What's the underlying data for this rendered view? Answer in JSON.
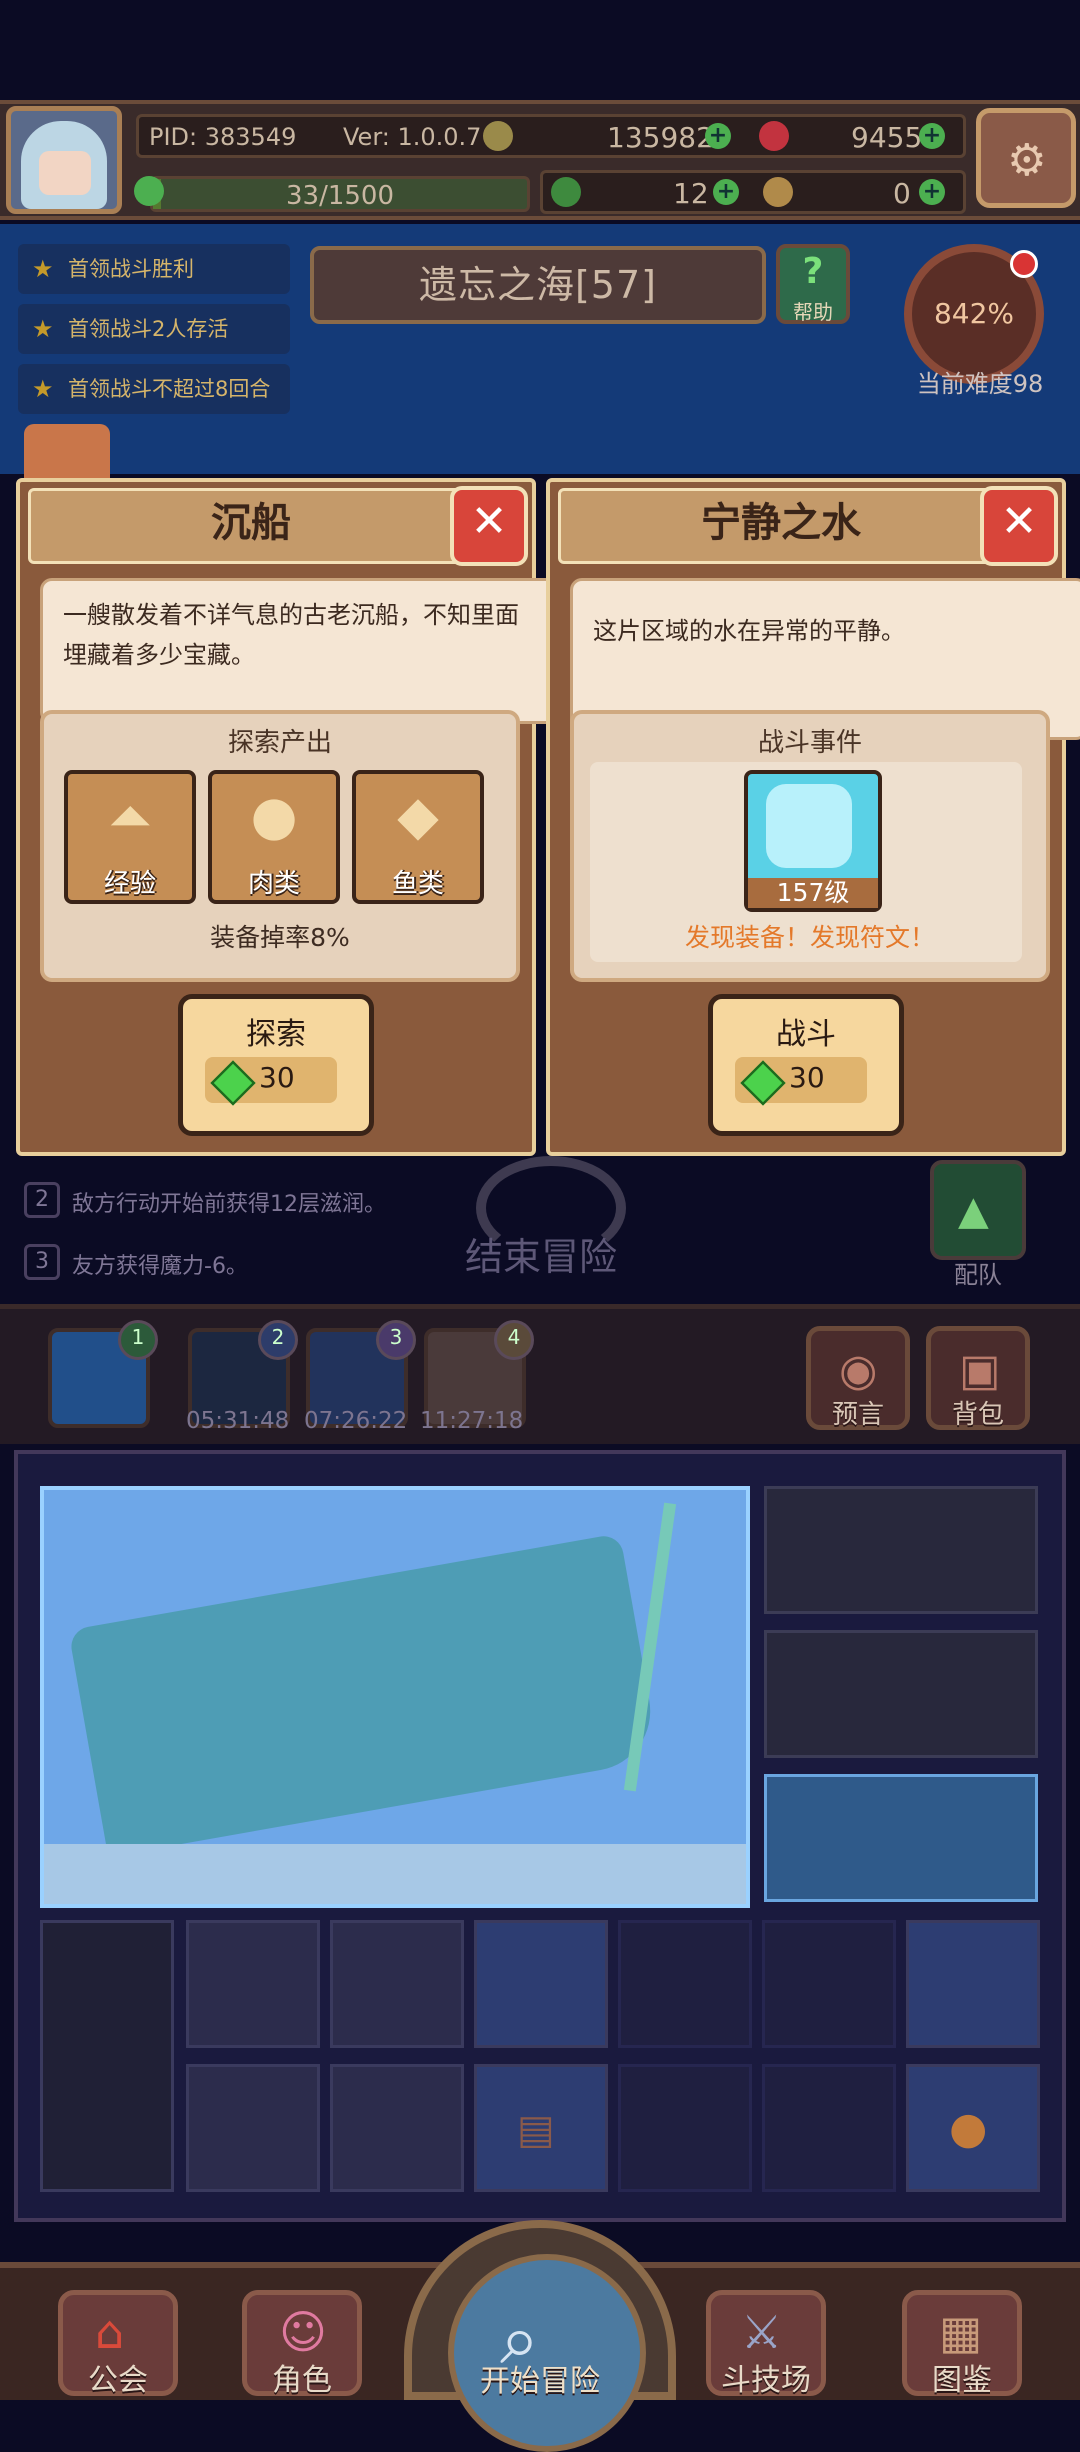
{
  "hud": {
    "pid": "PID: 383549",
    "version": "Ver: 1.0.0.7",
    "gold": "135982",
    "ruby": "9455",
    "stamina": "33/1500",
    "stamina_fraction": 0.022,
    "clover": "12",
    "bag": "0"
  },
  "quests": [
    "首领战斗胜利",
    "首领战斗2人存活",
    "首领战斗不超过8回合"
  ],
  "zone": {
    "name": "遗忘之海[57]",
    "help_label": "帮助",
    "difficulty_percent": "842%",
    "difficulty_label": "当前难度98"
  },
  "card_left": {
    "title": "沉船",
    "description": "一艘散发着不详气息的古老沉船，不知里面埋藏着多少宝藏。",
    "section_title": "探索产出",
    "rewards": [
      "经验",
      "肉类",
      "鱼类"
    ],
    "drop_rate": "装备掉率8%",
    "action_label": "探索",
    "cost": "30"
  },
  "card_right": {
    "title": "宁静之水",
    "description": "这片区域的水在异常的平静。",
    "section_title": "战斗事件",
    "enemy_level": "157级",
    "event_text": "发现装备！发现符文！",
    "action_label": "战斗",
    "cost": "30"
  },
  "tips": [
    {
      "num": "2",
      "text": "敌方行动开始前获得12层滋润。"
    },
    {
      "num": "3",
      "text": "友方获得魔力-6。"
    }
  ],
  "end_adventure": "结束冒险",
  "team_label": "配队",
  "slots": [
    {
      "badge": "1",
      "timer": ""
    },
    {
      "badge": "2",
      "timer": "05:31:48"
    },
    {
      "badge": "3",
      "timer": "07:26:22"
    },
    {
      "badge": "4",
      "timer": "11:27:18"
    }
  ],
  "preview_label": "预言",
  "bag_label": "背包",
  "nav": {
    "guild": "公会",
    "character": "角色",
    "start": "开始冒险",
    "arena": "斗技场",
    "codex": "图鉴"
  }
}
